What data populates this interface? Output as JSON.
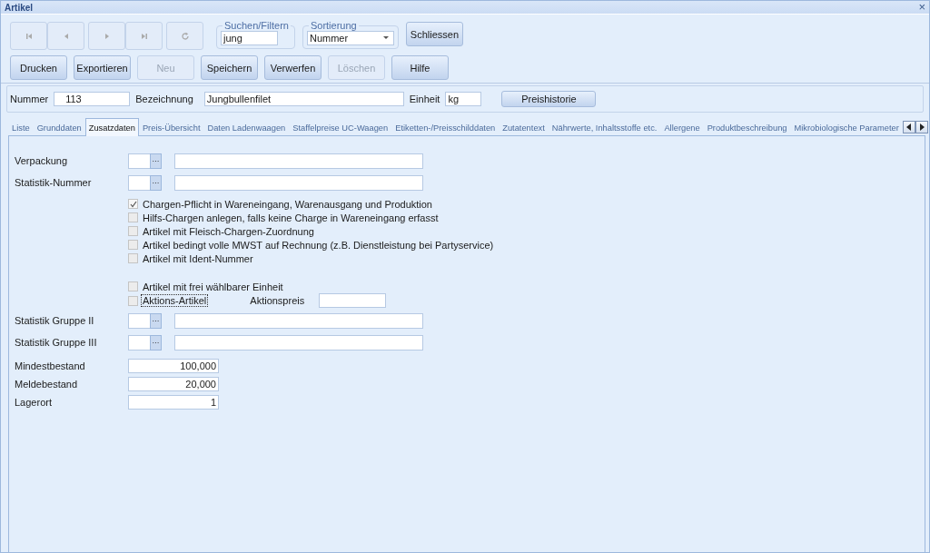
{
  "window": {
    "title": "Artikel",
    "close": "×"
  },
  "nav_buttons": [
    {
      "kind": "first",
      "disabled": true
    },
    {
      "kind": "prev",
      "disabled": true
    },
    {
      "kind": "next",
      "disabled": true
    },
    {
      "kind": "last",
      "disabled": true
    },
    {
      "kind": "refresh",
      "disabled": true
    }
  ],
  "search": {
    "label": "Suchen/Filtern",
    "value": "jung"
  },
  "sort": {
    "label": "Sortierung",
    "value": "Nummer"
  },
  "close_button": {
    "label": "Schliessen",
    "disabled": false
  },
  "action_buttons": [
    {
      "label": "Drucken",
      "disabled": false
    },
    {
      "label": "Exportieren",
      "disabled": false
    },
    {
      "label": "Neu",
      "disabled": true
    },
    {
      "label": "Speichern",
      "disabled": false
    },
    {
      "label": "Verwerfen",
      "disabled": false
    },
    {
      "label": "Löschen",
      "disabled": true
    },
    {
      "label": "Hilfe",
      "disabled": false
    }
  ],
  "header": {
    "number_label": "Nummer",
    "number": "113",
    "name_label": "Bezeichnung",
    "name": "Jungbullenfilet",
    "unit_label": "Einheit",
    "unit": "kg",
    "history_button": "Preishistorie"
  },
  "tabs": [
    {
      "label": "Liste",
      "selected": false
    },
    {
      "label": "Grunddaten",
      "selected": false
    },
    {
      "label": "Zusatzdaten",
      "selected": true
    },
    {
      "label": "Preis-Übersicht",
      "selected": false
    },
    {
      "label": "Daten Ladenwaagen",
      "selected": false
    },
    {
      "label": "Staffelpreise UC-Waagen",
      "selected": false
    },
    {
      "label": "Etiketten-/Preisschilddaten",
      "selected": false
    },
    {
      "label": "Zutatentext",
      "selected": false
    },
    {
      "label": "Nährwerte, Inhaltsstoffe etc.",
      "selected": false
    },
    {
      "label": "Allergene",
      "selected": false
    },
    {
      "label": "Produktbeschreibung",
      "selected": false
    },
    {
      "label": "Mikrobiologische Parameter",
      "selected": false
    }
  ],
  "lookups_top": [
    {
      "label": "Verpackung",
      "button": "···"
    },
    {
      "label": "Statistik-Nummer",
      "button": "···"
    }
  ],
  "checkboxes": [
    {
      "label": "Chargen-Pflicht in Wareneingang, Warenausgang und Produktion",
      "checked": true,
      "focused": false
    },
    {
      "label": "Hilfs-Chargen anlegen, falls keine Charge in Wareneingang erfasst",
      "checked": false,
      "focused": false
    },
    {
      "label": "Artikel mit Fleisch-Chargen-Zuordnung",
      "checked": false,
      "focused": false
    },
    {
      "label": "Artikel bedingt volle MWST auf Rechnung (z.B. Dienstleistung bei Partyservice)",
      "checked": false,
      "focused": false
    },
    {
      "label": "Artikel mit Ident-Nummer",
      "checked": false,
      "focused": false
    }
  ],
  "checkboxes_2": [
    {
      "label": "Artikel mit frei wählbarer Einheit",
      "checked": false,
      "focused": false
    },
    {
      "label": "Aktions-Artikel",
      "checked": false,
      "focused": true
    }
  ],
  "promo_price_label": "Aktionspreis",
  "lookups_bottom": [
    {
      "label": "Statistik Gruppe II",
      "button": "···"
    },
    {
      "label": "Statistik  Gruppe III",
      "button": "···"
    }
  ],
  "stock_fields": [
    {
      "label": "Mindestbestand",
      "value": "100,000"
    },
    {
      "label": "Meldebestand",
      "value": "20,000"
    },
    {
      "label": "Lagerort",
      "value": "1"
    }
  ]
}
